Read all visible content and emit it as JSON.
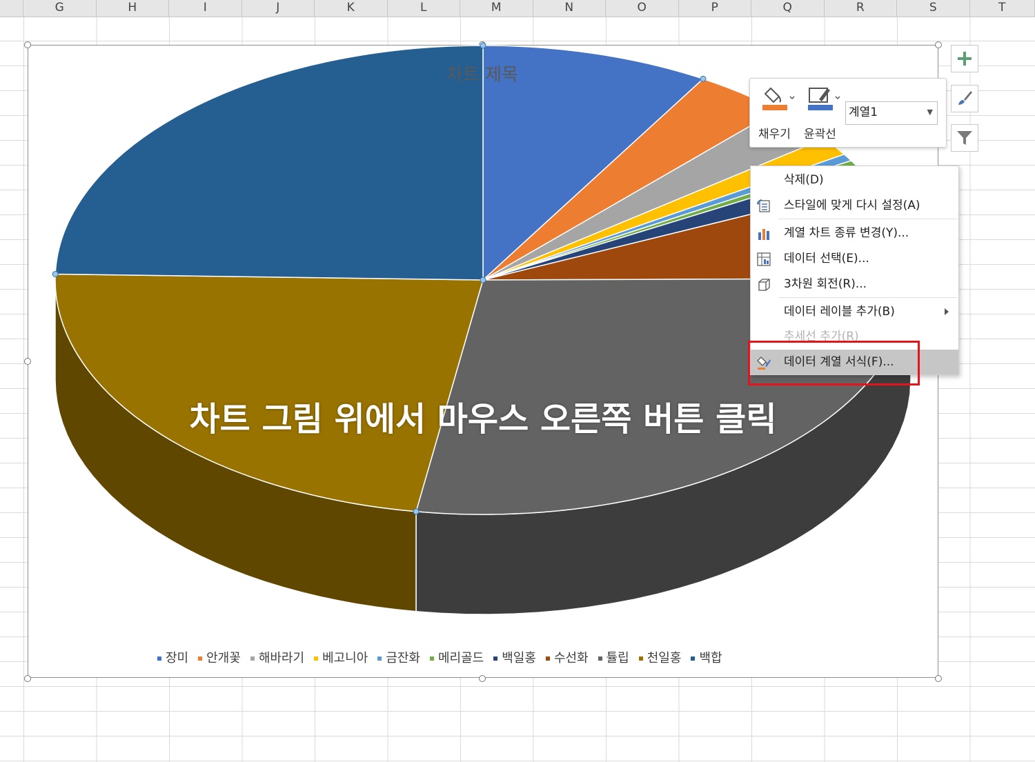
{
  "spreadsheet": {
    "columns": [
      "G",
      "H",
      "I",
      "J",
      "K",
      "L",
      "M",
      "N",
      "O",
      "P",
      "Q",
      "R",
      "S",
      "T"
    ]
  },
  "chart": {
    "title": "차트 제목"
  },
  "chart_data": {
    "type": "pie",
    "title": "차트 제목",
    "style": "3d-pie",
    "legend_position": "bottom",
    "categories": [
      "장미",
      "안개꽃",
      "해바라기",
      "베고니아",
      "금잔화",
      "메리골드",
      "백일홍",
      "수선화",
      "튤립",
      "천일홍",
      "백합"
    ],
    "values": [
      8.6,
      3.5,
      2.6,
      1.3,
      0.5,
      0.4,
      1.4,
      6.6,
      27.6,
      22.9,
      24.6
    ],
    "colors": [
      "#4472c4",
      "#ed7d31",
      "#a5a5a5",
      "#ffc000",
      "#5b9bd5",
      "#70ad47",
      "#264478",
      "#9e480e",
      "#636363",
      "#997300",
      "#255e91"
    ]
  },
  "mini_toolbar": {
    "fill_label": "채우기",
    "outline_label": "윤곽선",
    "series_select_value": "계열1",
    "fill_color": "#ed7d31",
    "outline_color": "#4472c4"
  },
  "side_buttons": {
    "chart_elements_icon": "plus-icon",
    "chart_styles_icon": "brush-icon",
    "chart_filters_icon": "filter-icon"
  },
  "context_menu": {
    "items": [
      {
        "label": "삭제(D)",
        "icon": "",
        "enabled": true
      },
      {
        "label": "스타일에 맞게 다시 설정(A)",
        "icon": "reset-style-icon",
        "enabled": true
      },
      {
        "label": "계열 차트 종류 변경(Y)...",
        "icon": "chart-type-icon",
        "enabled": true
      },
      {
        "label": "데이터 선택(E)...",
        "icon": "select-data-icon",
        "enabled": true
      },
      {
        "label": "3차원 회전(R)...",
        "icon": "rotate-3d-icon",
        "enabled": true
      },
      {
        "label": "데이터 레이블 추가(B)",
        "icon": "",
        "enabled": true
      },
      {
        "label": "추세선 추가(R)",
        "icon": "",
        "enabled": false
      },
      {
        "label": "데이터 계열 서식(F)...",
        "icon": "format-series-icon",
        "enabled": true
      }
    ]
  },
  "overlay": {
    "caption": "차트 그림 위에서 마우스 오른쪽 버튼 클릭",
    "highlight_color": "#e4131c"
  }
}
